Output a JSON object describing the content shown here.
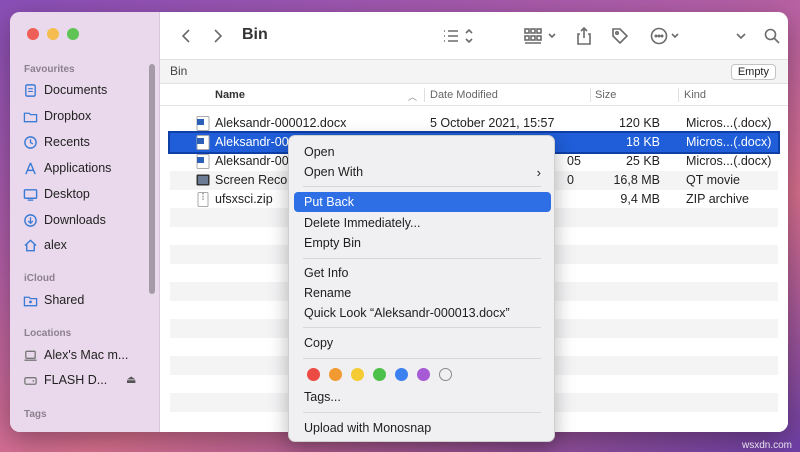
{
  "window": {
    "title": "Bin"
  },
  "sidebar": {
    "sections": {
      "favourites": "Favourites",
      "icloud": "iCloud",
      "locations": "Locations",
      "tags": "Tags"
    },
    "favourites": [
      {
        "label": "Documents",
        "icon": "document-icon"
      },
      {
        "label": "Dropbox",
        "icon": "folder-icon"
      },
      {
        "label": "Recents",
        "icon": "clock-icon"
      },
      {
        "label": "Applications",
        "icon": "applications-icon"
      },
      {
        "label": "Desktop",
        "icon": "desktop-icon"
      },
      {
        "label": "Downloads",
        "icon": "download-icon"
      },
      {
        "label": "alex",
        "icon": "home-icon"
      }
    ],
    "icloud": [
      {
        "label": "Shared",
        "icon": "shared-folder-icon"
      }
    ],
    "locations": [
      {
        "label": "Alex's Mac m...",
        "icon": "laptop-icon"
      },
      {
        "label": "FLASH D...",
        "icon": "drive-icon"
      }
    ]
  },
  "pathbar": {
    "location": "Bin",
    "empty_label": "Empty"
  },
  "columns": {
    "name": "Name",
    "date": "Date Modified",
    "size": "Size",
    "kind": "Kind"
  },
  "files": [
    {
      "name": "Aleksandr-000012.docx",
      "date": "5 October 2021, 15:57",
      "size": "120 KB",
      "kind": "Micros...(.docx)"
    },
    {
      "name": "Aleksandr-0000",
      "date": "",
      "size": "18 KB",
      "kind": "Micros...(.docx)"
    },
    {
      "name": "Aleksandr-0000",
      "date": "05",
      "size": "25 KB",
      "kind": "Micros...(.docx)"
    },
    {
      "name": "Screen Recordi",
      "date": "0",
      "size": "16,8 MB",
      "kind": "QT movie"
    },
    {
      "name": "ufsxsci.zip",
      "date": "",
      "size": "9,4 MB",
      "kind": "ZIP archive"
    }
  ],
  "context_menu": {
    "open": "Open",
    "open_with": "Open With",
    "put_back": "Put Back",
    "delete_immediately": "Delete Immediately...",
    "empty_bin": "Empty Bin",
    "get_info": "Get Info",
    "rename": "Rename",
    "quick_look": "Quick Look “Aleksandr-000013.docx”",
    "copy": "Copy",
    "tags": "Tags...",
    "upload": "Upload with Monosnap",
    "tag_colors": [
      "#ec4b43",
      "#f29a32",
      "#f4cb33",
      "#4cc04a",
      "#3b82f0",
      "#a65ad6",
      "none"
    ]
  },
  "watermark": "wsxdn.com"
}
